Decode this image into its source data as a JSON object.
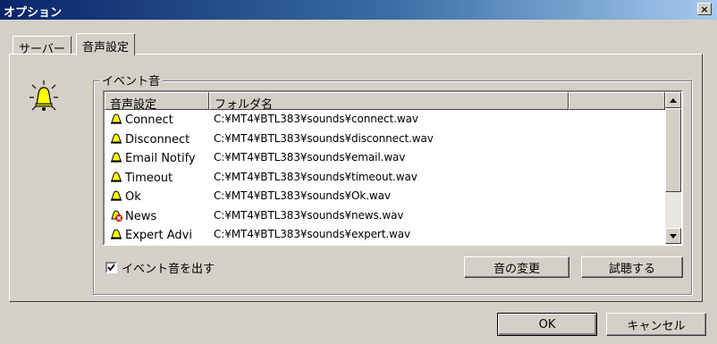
{
  "window": {
    "title": "オプション",
    "close_label": "×"
  },
  "tabs": [
    {
      "label": "サーバー",
      "active": false
    },
    {
      "label": "音声設定",
      "active": true
    }
  ],
  "group": {
    "legend": "イベント音"
  },
  "list": {
    "columns": [
      "音声設定",
      "フォルダ名"
    ],
    "rows": [
      {
        "name": "Connect",
        "path": "C:¥MT4¥BTL383¥sounds¥connect.wav",
        "icon": "bell-icon"
      },
      {
        "name": "Disconnect",
        "path": "C:¥MT4¥BTL383¥sounds¥disconnect.wav",
        "icon": "bell-icon"
      },
      {
        "name": "Email Notify",
        "path": "C:¥MT4¥BTL383¥sounds¥email.wav",
        "icon": "bell-icon"
      },
      {
        "name": "Timeout",
        "path": "C:¥MT4¥BTL383¥sounds¥timeout.wav",
        "icon": "bell-icon"
      },
      {
        "name": "Ok",
        "path": "C:¥MT4¥BTL383¥sounds¥Ok.wav",
        "icon": "bell-icon"
      },
      {
        "name": "News",
        "path": "C:¥MT4¥BTL383¥sounds¥news.wav",
        "icon": "bell-disabled-icon"
      },
      {
        "name": "Expert Advi",
        "path": "C:¥MT4¥BTL383¥sounds¥expert.wav",
        "icon": "bell-icon"
      }
    ]
  },
  "checkbox": {
    "label": "イベント音を出す",
    "checked": true
  },
  "buttons": {
    "change": "音の変更",
    "preview": "試聴する",
    "ok": "OK",
    "cancel": "キャンセル"
  },
  "colors": {
    "title_start": "#0a246a",
    "title_end": "#a6caf0",
    "face": "#d4d0c8",
    "bell": "#ffff00"
  }
}
